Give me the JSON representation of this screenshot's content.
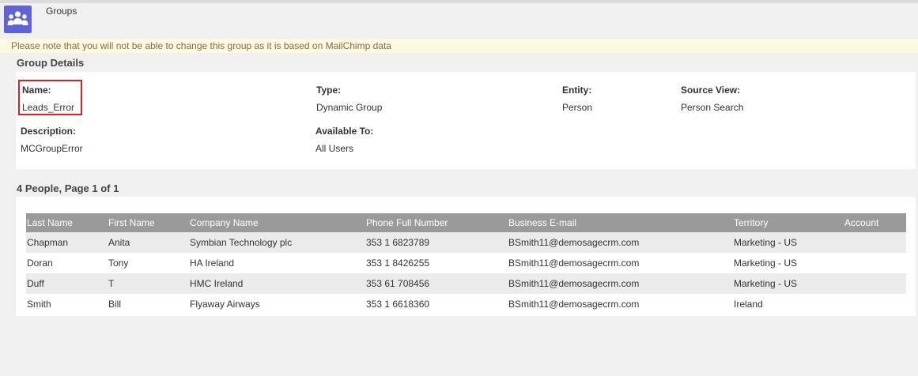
{
  "header": {
    "icon": "users-group-icon",
    "title": "Groups"
  },
  "notice": "Please note that you will not be able to change this group as it is based on MailChimp data",
  "group_details": {
    "section_title": "Group Details",
    "name": {
      "label": "Name:",
      "value": "Leads_Error"
    },
    "type": {
      "label": "Type:",
      "value": "Dynamic Group"
    },
    "entity": {
      "label": "Entity:",
      "value": "Person"
    },
    "source_view": {
      "label": "Source View:",
      "value": "Person Search"
    },
    "description": {
      "label": "Description:",
      "value": "MCGroupError"
    },
    "available_to": {
      "label": "Available To:",
      "value": "All Users"
    }
  },
  "people": {
    "section_title": "4 People, Page 1 of 1",
    "columns": [
      "Last Name",
      "First Name",
      "Company Name",
      "Phone Full Number",
      "Business E-mail",
      "Territory",
      "Account"
    ],
    "rows": [
      {
        "last_name": "Chapman",
        "first_name": "Anita",
        "company": "Symbian Technology plc",
        "phone": "353 1 6823789",
        "email": "BSmith11@demosagecrm.com",
        "territory": "Marketing - US",
        "account": ""
      },
      {
        "last_name": "Doran",
        "first_name": "Tony",
        "company": "HA Ireland",
        "phone": "353 1 8426255",
        "email": "BSmith11@demosagecrm.com",
        "territory": "Marketing - US",
        "account": ""
      },
      {
        "last_name": "Duff",
        "first_name": "T",
        "company": "HMC Ireland",
        "phone": "353 61 708456",
        "email": "BSmith11@demosagecrm.com",
        "territory": "Marketing - US",
        "account": ""
      },
      {
        "last_name": "Smith",
        "first_name": "Bill",
        "company": "Flyaway Airways",
        "phone": "353 1 6618360",
        "email": "BSmith11@demosagecrm.com",
        "territory": "Ireland",
        "account": ""
      }
    ]
  },
  "colors": {
    "icon_bg": "#5e64d8",
    "link": "#2e9e2e",
    "header_row": "#9a9a9a",
    "notice_bg": "#fdf8e2",
    "highlight_box": "#e02020"
  }
}
